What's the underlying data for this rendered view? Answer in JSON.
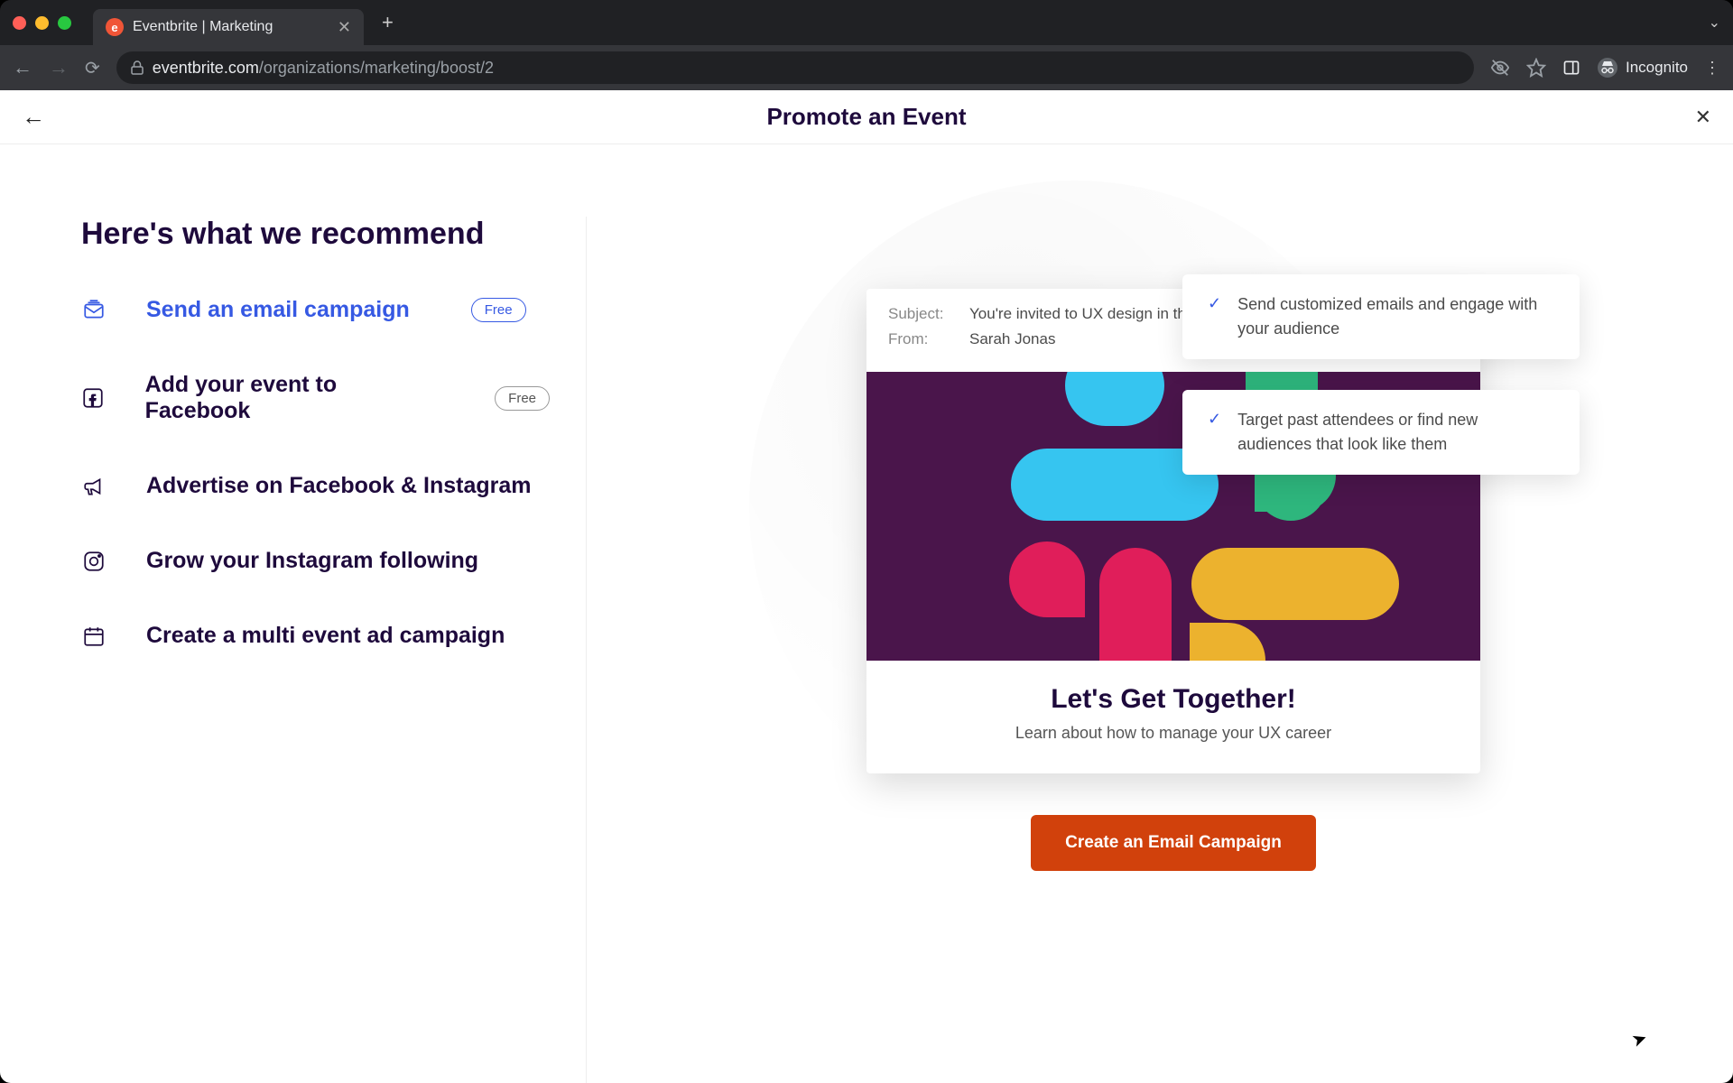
{
  "browser": {
    "tab_title": "Eventbrite | Marketing",
    "url_domain": "eventbrite.com",
    "url_path": "/organizations/marketing/boost/2",
    "incognito_label": "Incognito"
  },
  "page": {
    "title": "Promote an Event"
  },
  "left": {
    "heading": "Here's what we recommend",
    "items": [
      {
        "icon": "email",
        "title": "Send an email campaign",
        "badge": "Free",
        "active": true
      },
      {
        "icon": "facebook",
        "title": "Add your event to Facebook",
        "badge": "Free"
      },
      {
        "icon": "megaphone",
        "title": "Advertise on Facebook & Instagram"
      },
      {
        "icon": "instagram",
        "title": "Grow your Instagram following"
      },
      {
        "icon": "calendar",
        "title": "Create a multi event ad campaign"
      }
    ]
  },
  "bubbles": [
    "Send customized emails and engage with your audience",
    "Target past attendees or find new audiences that look like them"
  ],
  "email": {
    "subject_label": "Subject:",
    "subject_value": "You're invited to UX design in the face of a downturn!",
    "from_label": "From:",
    "from_value": "Sarah Jonas",
    "title": "Let's Get Together!",
    "subtitle": "Learn about how to manage your UX career"
  },
  "cta": {
    "label": "Create an Email Campaign"
  }
}
